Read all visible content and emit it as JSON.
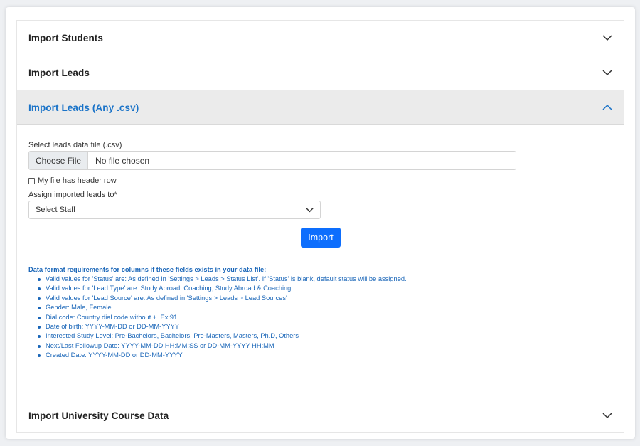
{
  "sections": [
    {
      "title": "Import Students",
      "expanded": false
    },
    {
      "title": "Import Leads",
      "expanded": false
    },
    {
      "title": "Import Leads (Any .csv)",
      "expanded": true
    },
    {
      "title": "Import University Course Data",
      "expanded": false
    }
  ],
  "form": {
    "file_label": "Select leads data file (.csv)",
    "file_button": "Choose File",
    "file_value": "No file chosen",
    "header_row_label": "My file has header row",
    "header_row_checked": false,
    "assign_label": "Assign imported leads to*",
    "assign_selected": "Select Staff",
    "import_button": "Import"
  },
  "requirements": {
    "title": "Data format requirements for columns if these fields exists in your data file:",
    "items": [
      "Valid values for 'Status' are: As defined in 'Settings > Leads > Status List'. If 'Status' is blank, default status will be assigned.",
      "Valid values for 'Lead Type' are: Study Abroad, Coaching, Study Abroad & Coaching",
      "Valid values for 'Lead Source' are: As defined in 'Settings > Leads > Lead Sources'",
      "Gender: Male, Female",
      "Dial code: Country dial code without +. Ex:91",
      "Date of birth: YYYY-MM-DD or DD-MM-YYYY",
      "Interested Study Level: Pre-Bachelors, Bachelors, Pre-Masters, Masters, Ph.D, Others",
      "Next/Last Followup Date: YYYY-MM-DD HH:MM:SS or DD-MM-YYYY HH:MM",
      "Created Date: YYYY-MM-DD or DD-MM-YYYY"
    ]
  },
  "colors": {
    "accent": "#1a73c8",
    "button": "#0d6efd",
    "active_header_bg": "#ebebeb"
  },
  "icons": {
    "collapsed": "chevron-down-icon",
    "expanded": "chevron-up-icon",
    "select": "chevron-down-icon"
  }
}
